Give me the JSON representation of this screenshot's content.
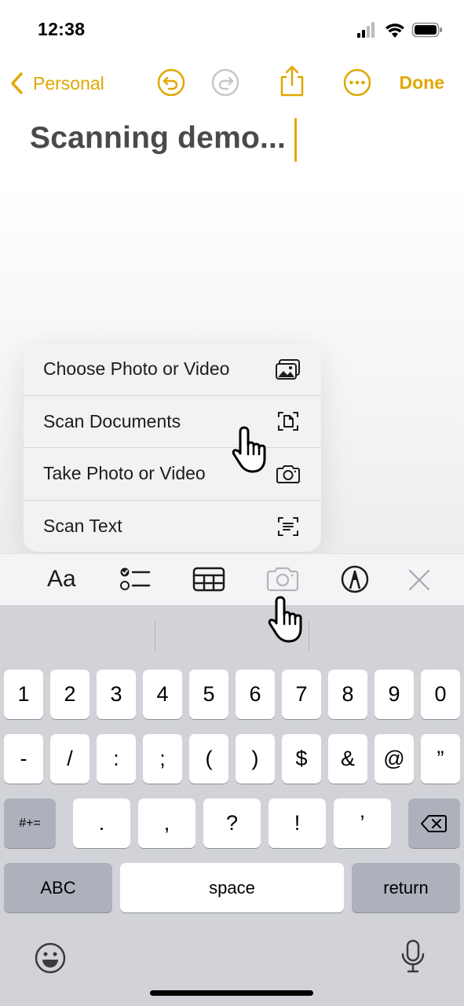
{
  "status_bar": {
    "time": "12:38"
  },
  "nav": {
    "back_label": "Personal",
    "done_label": "Done"
  },
  "note": {
    "title": "Scanning demo..."
  },
  "menu": {
    "items": [
      {
        "label": "Choose Photo or Video",
        "icon": "photo-library-icon"
      },
      {
        "label": "Scan Documents",
        "icon": "doc-scan-icon"
      },
      {
        "label": "Take Photo or Video",
        "icon": "camera-icon"
      },
      {
        "label": "Scan Text",
        "icon": "text-scan-icon"
      }
    ]
  },
  "toolbar": {
    "format_label": "Aa"
  },
  "keyboard": {
    "row1": [
      "1",
      "2",
      "3",
      "4",
      "5",
      "6",
      "7",
      "8",
      "9",
      "0"
    ],
    "row2": [
      "-",
      "/",
      ":",
      ";",
      "(",
      ")",
      "$",
      "&",
      "@",
      "”"
    ],
    "row3_left": "#+=",
    "row3": [
      ".",
      ",",
      "?",
      "!",
      "’"
    ],
    "abc_label": "ABC",
    "space_label": "space",
    "return_label": "return"
  },
  "colors": {
    "accent": "#e0a800",
    "keyboard_bg": "#d1d3d9"
  }
}
